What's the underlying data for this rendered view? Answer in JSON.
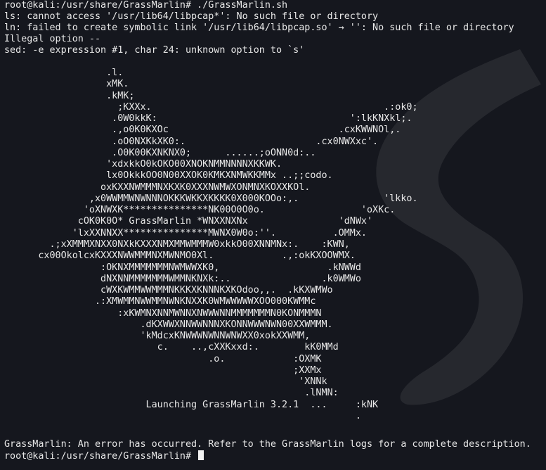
{
  "terminal": {
    "top_lines": [
      "root@kali:/usr/share/GrassMarlin# ./GrassMarlin.sh",
      "ls: cannot access '/usr/lib64/libpcap*': No such file or directory",
      "ln: failed to create symbolic link '/usr/lib64/libpcap.so' → '': No such file or directory",
      "Illegal option --",
      "sed: -e expression #1, char 24: unknown option to `s'"
    ],
    "ascii_art": "                  .l.\n                  xMK.\n                  .kMK;\n                    ;KXXx.                                         .:ok0;\n                   .0W0kkK:                                  ':lkKNXkl;.\n                   .,o0K0KXOc                              .cxKWWNOl,.\n                   .oO0NXKkXK0:.                       .cx0NWXxc'.\n                   .O0K00KXNKNX0;      ......;oONN0d:..\n                  'xdxkkO0kOKO00XNOKNMMNNNNXKKWK.\n                  lx0OkkkOO0N00XXOK0KMKXNMWKKMMx ..;;codo.\n                 oxKXXNWMMMNXKXK0XXXNWMWXONMNXKOXXKOl.\n               ,x0WWMMWNWNNNOKKKWKKXKKKK0X000KOOo:,.               'lkko.\n              'oXNWXK***************NK00O0O0o.                 'oXKc.\n             cOK0K0O* GrassMarlin *WNXXNXNx                'dNWx'\n            'lxXXNNXX***************MWNX0W0o:''.          .OMMx.\n        .;xXMMMXNXX0NXkKXXXNMXMMWMMMW0xkkO00XNNMNx:.    :KWN,\n      cx00OkolcxKXXXNWWMMMNXMWNMO0Xl.            .,:okKXOOWMX.\n                 :OKNXMMMMMMMNWMWWXK0,                   .kNWWd\n                 dNXNNMMMMMMMWMMNKNXk:..                .k0WMWo\n                 cWXKWMMWWMMMNKKKXKNNNKXKOdoo,,.  .kKXWMWo\n                .:XMWMMNWWMMNWNKNXXK0WMWWWWWXOO000KWMMc\n                    :xKWMNXNNMWNNXNWWWNNMMMMMMMN0KONMMMN\n                        .dKXWWXNNWWNNNXKONNWWWNWN00XXWMMM.\n                        'kMdcxKNWWWNWNNWNWXX0xokXXWMM,\n                           c.    ..,cXXKxxd:.        kK0MMd\n                                    .o.            :OXMK\n                                                   ;XXMx\n                                                    'XNNk\n                                                     .lNMN:\n                         Launching GrassMarlin 3.2.1  ...     :kNK\n                                                              .",
    "error_line": "GrassMarlin: An error has occurred. Refer to the GrassMarlin logs for a complete description.",
    "prompt": "root@kali:/usr/share/GrassMarlin# "
  }
}
